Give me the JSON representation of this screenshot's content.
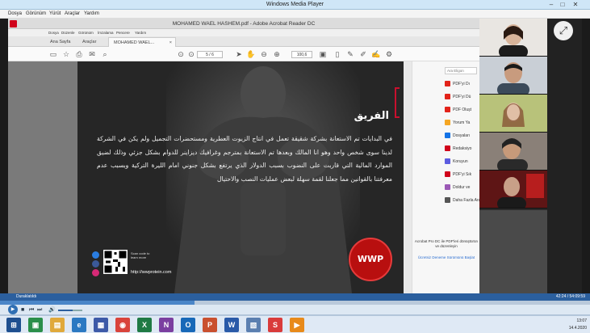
{
  "wmp": {
    "title": "Windows Media Player",
    "menu": [
      "Dosya",
      "Görünüm",
      "Yürüt",
      "Araçlar",
      "Yardım"
    ],
    "status": "Duraklatıldı",
    "time": "42:24 / 54:09:59",
    "progress": 0.33,
    "volume": 0.6
  },
  "acrobat": {
    "title": "MOHAMED WAEL HASHEM.pdf - Adobe Acrobat Reader DC",
    "menu": [
      "Dosya",
      "Düzenle",
      "Görünüm",
      "İmzalama",
      "Pencere",
      "Yardım"
    ],
    "tabs": [
      "Ana Sayfa",
      "Araçlar",
      "MOHAMED WAEL..."
    ],
    "tab_close": "×",
    "page_indicator": "5 / 6",
    "zoom": "100,6",
    "right_panel": {
      "search_placeholder": "Ara Eligon",
      "items": [
        {
          "label": "PDF'yi Dı",
          "color": "#e2231a"
        },
        {
          "label": "PDF'yi Dü",
          "color": "#e2231a"
        },
        {
          "label": "PDF Oluşt",
          "color": "#e2231a"
        },
        {
          "label": "Yorum Ya",
          "color": "#f5a623"
        },
        {
          "label": "Dosyaları",
          "color": "#1473e6"
        },
        {
          "label": "Redaksiyo",
          "color": "#d0021b"
        },
        {
          "label": "Koruyun",
          "color": "#5c5ce0"
        },
        {
          "label": "PDF'yi Sık",
          "color": "#d0021b"
        },
        {
          "label": "Doldur ve",
          "color": "#9b59b6"
        },
        {
          "label": "Daha Fazla Araç",
          "color": "#555555"
        }
      ],
      "promo": "Acrobat Pro DC ile PDF'leri dönüştürün ve düzenleyin",
      "promo_link": "Ücretsiz Deneme Sürümünü Başlat"
    }
  },
  "pdf": {
    "heading": "الفريق",
    "body": "في البدايات تم الاستعانة بشركة شقيقة تعمل في انتاج الزيوت العطرية ومستحضرات التجميل ولم يكن في الشركة لدينا سوى شخص واحد وهو انا المالك وبعدها تم الاستعانة بمترجم وغرافيك ديزاينر للدوام بشكل جزئي وذلك لضيق الموارد المالية التي قاربت على النضوب بسبب الدولار الذي يرتفع بشكل جنوني امام الليرة التركية وبسبب عدم معرفتنا بالقوانين مما جعلنا لقمة سهلة لبعض عمليات النصب والاحتيال",
    "qr_label": "Scan code to learn more",
    "website": "http://wwprotein.com",
    "logo_text": "WWP"
  },
  "taskbar": {
    "clock_time": "13:07",
    "clock_date": "14.4.2020",
    "apps": [
      {
        "name": "start",
        "glyph": "⊞",
        "color": "#1e4f8f"
      },
      {
        "name": "explorer",
        "glyph": "▣",
        "color": "#2b8f4a"
      },
      {
        "name": "files",
        "glyph": "▤",
        "color": "#e0a93b"
      },
      {
        "name": "ie",
        "glyph": "e",
        "color": "#2b79c2"
      },
      {
        "name": "app5",
        "glyph": "▦",
        "color": "#3d5aa8"
      },
      {
        "name": "chrome",
        "glyph": "◉",
        "color": "#d9433b"
      },
      {
        "name": "excel",
        "glyph": "X",
        "color": "#1f7a44"
      },
      {
        "name": "onenote",
        "glyph": "N",
        "color": "#7b3fa0"
      },
      {
        "name": "outlook",
        "glyph": "O",
        "color": "#1768b8"
      },
      {
        "name": "powerpoint",
        "glyph": "P",
        "color": "#c9502f"
      },
      {
        "name": "word",
        "glyph": "W",
        "color": "#2a5aa8"
      },
      {
        "name": "app12",
        "glyph": "▧",
        "color": "#5b7fb0"
      },
      {
        "name": "skype",
        "glyph": "S",
        "color": "#d93b3b"
      },
      {
        "name": "media",
        "glyph": "▶",
        "color": "#e88a1a"
      }
    ]
  }
}
